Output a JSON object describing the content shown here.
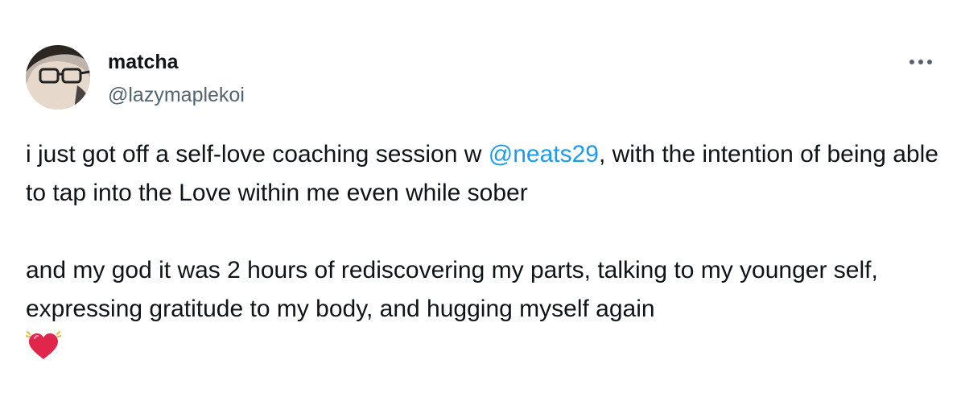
{
  "author": {
    "display_name": "matcha",
    "handle": "@lazymaplekoi",
    "avatar_icon": "avatar-photo"
  },
  "more_icon": "more-horizontal-icon",
  "tweet": {
    "line1_before": "i just got off a self-love coaching session w ",
    "mention": "@neats29",
    "line1_after": ", with the intention of being able to tap into the Love within me even while sober",
    "paragraph2": "and my god it was 2 hours of rediscovering my parts, talking to my younger self, expressing gratitude to my body, and hugging myself again",
    "emoji": "beating-heart-emoji"
  },
  "colors": {
    "text": "#0f1419",
    "secondary": "#536471",
    "link": "#1d9bf0",
    "heart": "#e0264a"
  }
}
